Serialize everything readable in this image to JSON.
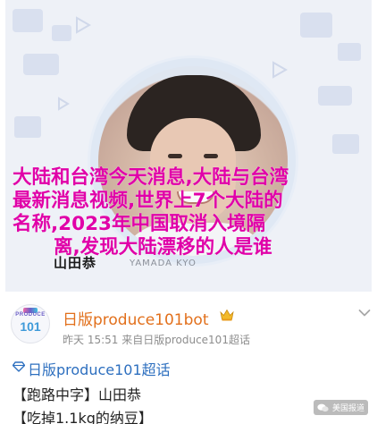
{
  "profile_card": {
    "name_jp": "山田恭",
    "name_romaji": "YAMADA KYO"
  },
  "overlay": {
    "lines": [
      "大陆和台湾今天消息,大陆与台湾",
      "最新消息视频,世界上7个大陆的",
      "名称,2023年中国取消入境隔",
      "离,发现大陆漂移的人是谁"
    ],
    "color": "#e000a8"
  },
  "post": {
    "avatar_logo_top": "PRODUCE",
    "avatar_logo_main": "101",
    "account_name": "日版produce101bot",
    "meta": "昨天 15:51  来自日版produce101超话",
    "topic": "日版produce101超话",
    "lines": [
      "【跑路中字】山田恭",
      "【吃掉1.1kg的纳豆】"
    ],
    "account_color": "#e2701c",
    "topic_color": "#2d6fbf"
  },
  "watermark": {
    "text": "美国报道"
  }
}
